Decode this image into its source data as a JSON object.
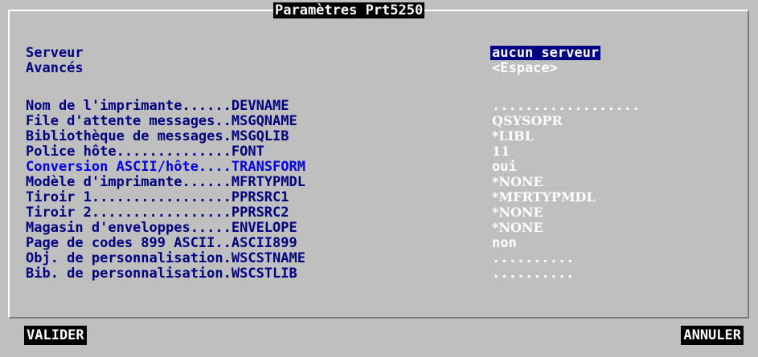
{
  "window": {
    "title": "Paramètres Prt5250"
  },
  "general": {
    "server_label": "Serveur",
    "server_value": "aucun serveur",
    "advanced_label": "Avancés",
    "advanced_value": "<Espace>"
  },
  "params": [
    {
      "label": "Nom de l'imprimante......DEVNAME",
      "value": ".................."
    },
    {
      "label": "File d'attente messages..MSGQNAME",
      "value": "QSYSOPR"
    },
    {
      "label": "Bibliothèque de messages.MSGQLIB",
      "value": "*LIBL"
    },
    {
      "label": "Police hôte..............FONT",
      "value": "11"
    },
    {
      "label": "Conversion ASCII/hôte....TRANSFORM",
      "value": "oui"
    },
    {
      "label": "Modèle d'imprimante......MFRTYPMDL",
      "value": "*NONE"
    },
    {
      "label": "Tiroir 1.................PPRSRC1",
      "value": "*MFRTYPMDL"
    },
    {
      "label": "Tiroir 2.................PPRSRC2",
      "value": "*NONE"
    },
    {
      "label": "Magasin d'enveloppes.....ENVELOPE",
      "value": "*NONE"
    },
    {
      "label": "Page de codes 899 ASCII..ASCII899",
      "value": "non"
    },
    {
      "label": "Obj. de personnalisation.WSCSTNAME",
      "value": ".........."
    },
    {
      "label": "Bib. de personnalisation.WSCSTLIB",
      "value": ".........."
    }
  ],
  "footer": {
    "ok_label": "VALIDER",
    "cancel_label": "ANNULER"
  }
}
